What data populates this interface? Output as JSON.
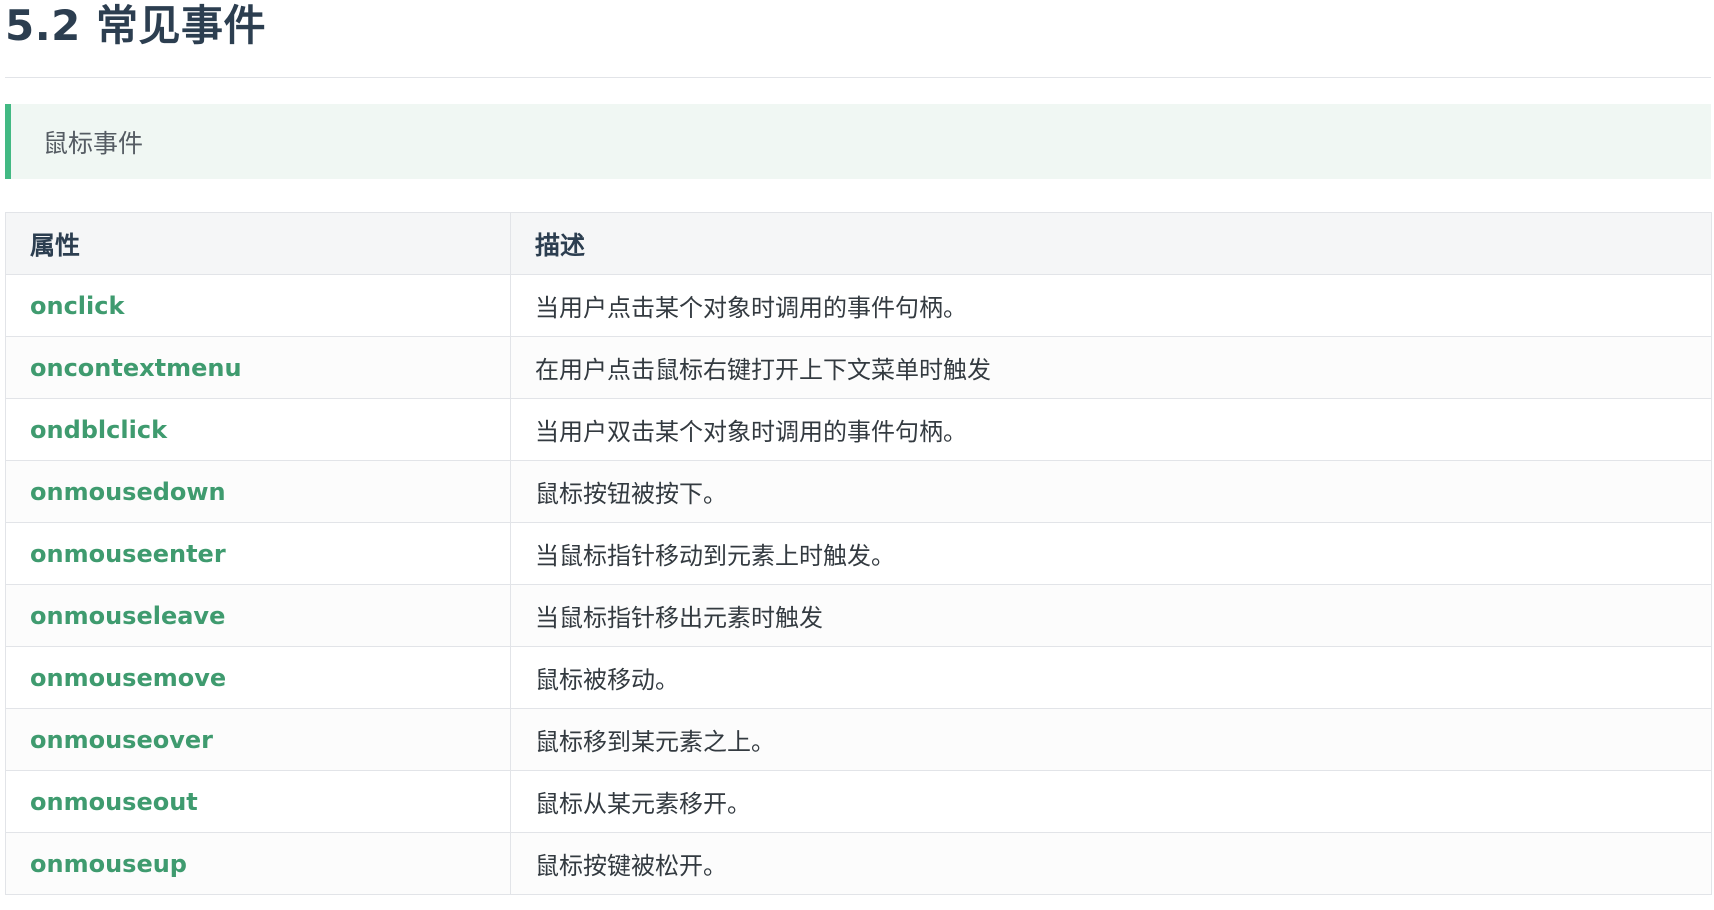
{
  "heading": "5.2 常见事件",
  "tip": "鼠标事件",
  "table": {
    "headers": [
      "属性",
      "描述"
    ],
    "rows": [
      {
        "attr": "onclick",
        "desc": "当用户点击某个对象时调用的事件句柄。"
      },
      {
        "attr": "oncontextmenu",
        "desc": "在用户点击鼠标右键打开上下文菜单时触发"
      },
      {
        "attr": "ondblclick",
        "desc": "当用户双击某个对象时调用的事件句柄。"
      },
      {
        "attr": "onmousedown",
        "desc": "鼠标按钮被按下。"
      },
      {
        "attr": "onmouseenter",
        "desc": "当鼠标指针移动到元素上时触发。"
      },
      {
        "attr": "onmouseleave",
        "desc": "当鼠标指针移出元素时触发"
      },
      {
        "attr": "onmousemove",
        "desc": "鼠标被移动。"
      },
      {
        "attr": "onmouseover",
        "desc": "鼠标移到某元素之上。"
      },
      {
        "attr": "onmouseout",
        "desc": "鼠标从某元素移开。"
      },
      {
        "attr": "onmouseup",
        "desc": "鼠标按键被松开。"
      }
    ]
  }
}
